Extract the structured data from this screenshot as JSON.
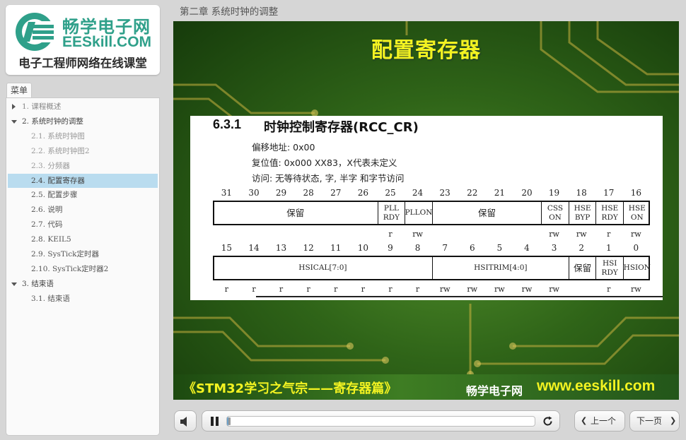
{
  "logo": {
    "name_cn": "畅学电子网",
    "name_en": "EESkill.COM",
    "tagline": "电子工程师网络在线课堂"
  },
  "menu": {
    "tab_label": "菜单",
    "items": [
      {
        "label": "1. 课程概述",
        "level": 1,
        "state": "collapsed"
      },
      {
        "label": "2. 系统时钟的调整",
        "level": 1,
        "state": "expanded"
      },
      {
        "label": "2.1. 系统时钟图",
        "level": 2,
        "state": "visited"
      },
      {
        "label": "2.2. 系统时钟图2",
        "level": 2,
        "state": "visited"
      },
      {
        "label": "2.3. 分频器",
        "level": 2,
        "state": "visited"
      },
      {
        "label": "2.4. 配置寄存器",
        "level": 2,
        "state": "active"
      },
      {
        "label": "2.5. 配置步骤",
        "level": 2,
        "state": "normal"
      },
      {
        "label": "2.6. 说明",
        "level": 2,
        "state": "normal"
      },
      {
        "label": "2.7. 代码",
        "level": 2,
        "state": "normal"
      },
      {
        "label": "2.8. KEIL5",
        "level": 2,
        "state": "normal"
      },
      {
        "label": "2.9. SysTick定时器",
        "level": 2,
        "state": "normal"
      },
      {
        "label": "2.10. SysTick定时器2",
        "level": 2,
        "state": "normal"
      },
      {
        "label": "3. 结束语",
        "level": 1,
        "state": "expanded"
      },
      {
        "label": "3.1. 结束语",
        "level": 2,
        "state": "normal"
      }
    ]
  },
  "header": {
    "chapter_title": "第二章 系统时钟的调整"
  },
  "slide": {
    "title": "配置寄存器",
    "doc": {
      "section_number": "6.3.1",
      "section_title": "时钟控制寄存器(RCC_CR)",
      "offset": "偏移地址: 0x00",
      "reset": "复位值: 0x000 XX83，X代表未定义",
      "access": "访问: 无等待状态, 字, 半字 和字节访问",
      "bits_high": [
        "31",
        "30",
        "29",
        "28",
        "27",
        "26",
        "25",
        "24",
        "23",
        "22",
        "21",
        "20",
        "19",
        "18",
        "17",
        "16"
      ],
      "bits_low": [
        "15",
        "14",
        "13",
        "12",
        "11",
        "10",
        "9",
        "8",
        "7",
        "6",
        "5",
        "4",
        "3",
        "2",
        "1",
        "0"
      ],
      "fields_high": [
        {
          "label": "保留",
          "span": 6
        },
        {
          "label": "PLL RDY",
          "span": 1
        },
        {
          "label": "PLLON",
          "span": 1
        },
        {
          "label": "保留",
          "span": 4
        },
        {
          "label": "CSS ON",
          "span": 1
        },
        {
          "label": "HSE BYP",
          "span": 1
        },
        {
          "label": "HSE RDY",
          "span": 1
        },
        {
          "label": "HSE ON",
          "span": 1
        }
      ],
      "fields_low": [
        {
          "label": "HSICAL[7:0]",
          "span": 8
        },
        {
          "label": "HSITRIM[4:0]",
          "span": 5
        },
        {
          "label": "保留",
          "span": 1
        },
        {
          "label": "HSI RDY",
          "span": 1
        },
        {
          "label": "HSION",
          "span": 1
        }
      ],
      "access_high": [
        "",
        "",
        "",
        "",
        "",
        "",
        "r",
        "rw",
        "",
        "",
        "",
        "",
        "rw",
        "rw",
        "r",
        "rw"
      ],
      "access_low": [
        "r",
        "r",
        "r",
        "r",
        "r",
        "r",
        "r",
        "r",
        "rw",
        "rw",
        "rw",
        "rw",
        "rw",
        "",
        "r",
        "rw"
      ]
    },
    "footer_left": "《STM32学习之气宗——寄存器篇》",
    "footer_brand": "畅学电子网",
    "footer_url": "www.eeskill.com"
  },
  "player": {
    "progress": 0.005,
    "prev_label": "上一个",
    "next_label": "下一页"
  },
  "colors": {
    "accent_blue": "#b9dcef",
    "logo_green": "#2fa08a",
    "slide_yellow": "#f3f321"
  }
}
